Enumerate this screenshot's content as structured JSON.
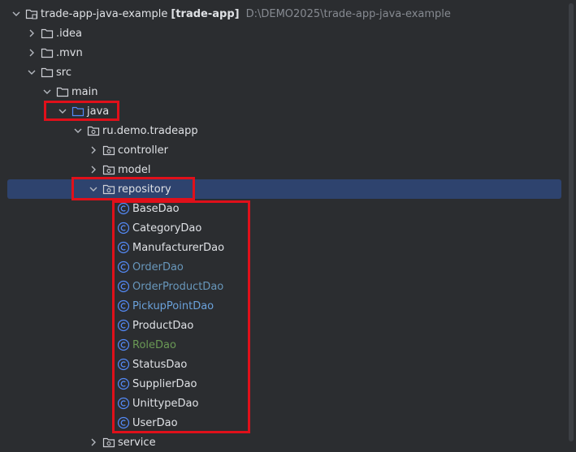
{
  "tree": {
    "root": {
      "name": "trade-app-java-example",
      "module": "[trade-app]",
      "path": "D:\\DEMO2025\\trade-app-java-example"
    },
    "idea": ".idea",
    "mvn": ".mvn",
    "src": "src",
    "main": "main",
    "java": "java",
    "package": "ru.demo.tradeapp",
    "controller": "controller",
    "model": "model",
    "repository": "repository",
    "classes": [
      {
        "name": "BaseDao",
        "color": "#dfe1e5"
      },
      {
        "name": "CategoryDao",
        "color": "#dfe1e5"
      },
      {
        "name": "ManufacturerDao",
        "color": "#dfe1e5"
      },
      {
        "name": "OrderDao",
        "color": "#6897bb"
      },
      {
        "name": "OrderProductDao",
        "color": "#6897bb"
      },
      {
        "name": "PickupPointDao",
        "color": "#6aa1da"
      },
      {
        "name": "ProductDao",
        "color": "#dfe1e5"
      },
      {
        "name": "RoleDao",
        "color": "#6a9955"
      },
      {
        "name": "StatusDao",
        "color": "#dfe1e5"
      },
      {
        "name": "SupplierDao",
        "color": "#dfe1e5"
      },
      {
        "name": "UnittypeDao",
        "color": "#dfe1e5"
      },
      {
        "name": "UserDao",
        "color": "#dfe1e5"
      }
    ],
    "service": "service"
  },
  "colors": {
    "highlight": "#e0101a",
    "selection": "#2e436e",
    "background": "#2b2d30"
  }
}
